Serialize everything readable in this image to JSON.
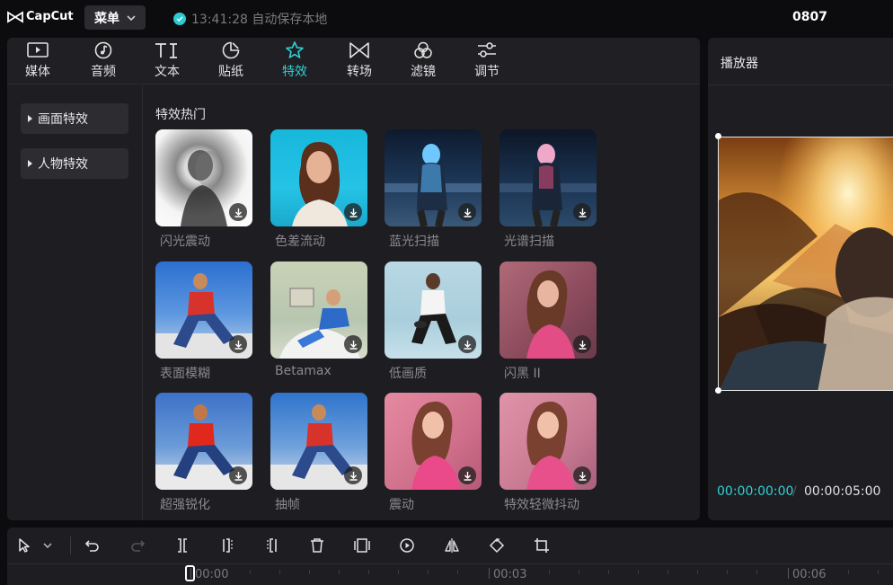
{
  "app": {
    "logo_text": "CapCut",
    "menu_label": "菜单",
    "autosave_text": "13:41:28 自动保存本地",
    "project_name": "0807"
  },
  "tabs": [
    {
      "label": "媒体",
      "icon": "media-icon"
    },
    {
      "label": "音频",
      "icon": "audio-icon"
    },
    {
      "label": "文本",
      "icon": "text-icon"
    },
    {
      "label": "贴纸",
      "icon": "sticker-icon"
    },
    {
      "label": "特效",
      "icon": "effects-icon",
      "active": true
    },
    {
      "label": "转场",
      "icon": "transition-icon"
    },
    {
      "label": "滤镜",
      "icon": "filter-icon"
    },
    {
      "label": "调节",
      "icon": "adjust-icon"
    }
  ],
  "sidebar": {
    "items": [
      {
        "label": "画面特效"
      },
      {
        "label": "人物特效"
      }
    ]
  },
  "section": {
    "title": "特效热门"
  },
  "effects": [
    {
      "label": "闪光震动"
    },
    {
      "label": "色差流动"
    },
    {
      "label": "蓝光扫描"
    },
    {
      "label": "光谱扫描"
    },
    {
      "label": "表面模糊"
    },
    {
      "label": "Betamax"
    },
    {
      "label": "低画质"
    },
    {
      "label": "闪黑 II"
    },
    {
      "label": "超强锐化"
    },
    {
      "label": "抽帧"
    },
    {
      "label": "震动"
    },
    {
      "label": "特效轻微抖动"
    }
  ],
  "player": {
    "title": "播放器",
    "current_time": "00:00:00:00",
    "separator": "/",
    "total_time": "00:00:05:00"
  },
  "timeline": {
    "ticks": [
      "00:00",
      "00:03",
      "00:06"
    ]
  },
  "colors": {
    "accent": "#2fd0d6",
    "panel": "#1e1e22",
    "background": "#0c0c0e"
  }
}
